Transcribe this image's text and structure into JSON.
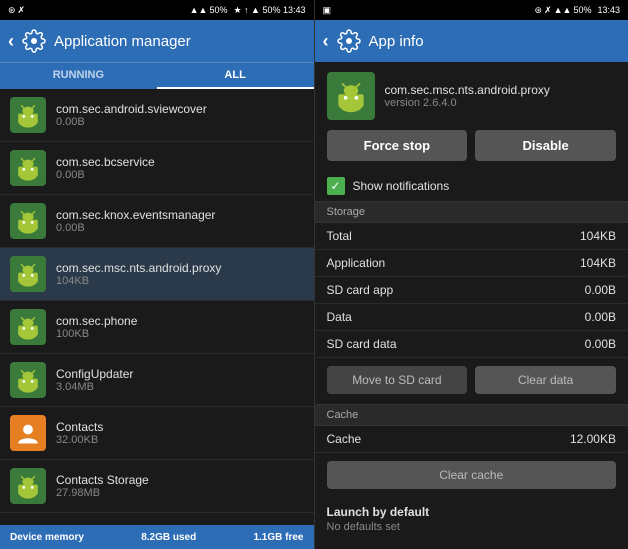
{
  "statusBar": {
    "leftIcons": "♪ ✗",
    "rightIcons": "★ ↑ ▲ 50% 13:43"
  },
  "leftPanel": {
    "headerTitle": "Application manager",
    "backArrow": "‹",
    "tabs": [
      {
        "label": "RUNNING",
        "active": false
      },
      {
        "label": "ALL",
        "active": true
      }
    ],
    "apps": [
      {
        "name": "com.sec.android.sviewcover",
        "size": "0.00B",
        "iconType": "android",
        "highlighted": false
      },
      {
        "name": "com.sec.bcservice",
        "size": "0.00B",
        "iconType": "android",
        "highlighted": false
      },
      {
        "name": "com.sec.knox.eventsmanager",
        "size": "0.00B",
        "iconType": "android",
        "highlighted": false
      },
      {
        "name": "com.sec.msc.nts.android.proxy",
        "size": "104KB",
        "iconType": "android",
        "highlighted": true
      },
      {
        "name": "com.sec.phone",
        "size": "100KB",
        "iconType": "android",
        "highlighted": false
      },
      {
        "name": "ConfigUpdater",
        "size": "3.04MB",
        "iconType": "android",
        "highlighted": false
      },
      {
        "name": "Contacts",
        "size": "32.00KB",
        "iconType": "contacts",
        "highlighted": false
      },
      {
        "name": "Contacts Storage",
        "size": "27.98MB",
        "iconType": "android",
        "highlighted": false
      }
    ],
    "bottomBar": {
      "used": "8.2GB used",
      "free": "1.1GB free",
      "label": "Device memory"
    }
  },
  "rightPanel": {
    "headerTitle": "App info",
    "backArrow": "‹",
    "app": {
      "packageName": "com.sec.msc.nts.android.proxy",
      "version": "version 2.6.4.0"
    },
    "buttons": {
      "forceStop": "Force stop",
      "disable": "Disable"
    },
    "showNotifications": {
      "label": "Show notifications",
      "checked": true
    },
    "storage": {
      "sectionLabel": "Storage",
      "rows": [
        {
          "label": "Total",
          "value": "104KB"
        },
        {
          "label": "Application",
          "value": "104KB"
        },
        {
          "label": "SD card app",
          "value": "0.00B"
        },
        {
          "label": "Data",
          "value": "0.00B"
        },
        {
          "label": "SD card data",
          "value": "0.00B"
        }
      ],
      "moveToSD": "Move to SD card",
      "clearData": "Clear data"
    },
    "cache": {
      "sectionLabel": "Cache",
      "rows": [
        {
          "label": "Cache",
          "value": "12.00KB"
        }
      ],
      "clearCache": "Clear cache"
    },
    "launchByDefault": {
      "header": "Launch by default",
      "value": "No defaults set"
    }
  },
  "icons": {
    "bluetooth": "⊛",
    "mute": "✗",
    "signal": "▲",
    "battery": "▐",
    "settings": "⚙",
    "checkmark": "✓"
  }
}
